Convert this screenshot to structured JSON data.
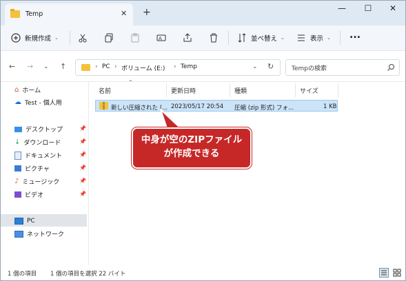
{
  "window": {
    "tab_title": "Temp",
    "new_tab": "+",
    "close_tab": "✕",
    "controls": {
      "minimize": "—",
      "maximize": "☐",
      "close": "✕"
    }
  },
  "commandbar": {
    "new_label": "新規作成",
    "sort_label": "並べ替え",
    "view_label": "表示",
    "more": "..."
  },
  "address": {
    "crumbs": [
      "PC",
      "ボリューム (E:)",
      "Temp"
    ],
    "search_placeholder": "Tempの検索"
  },
  "sidebar": {
    "items": [
      {
        "label": "ホーム"
      },
      {
        "label": "Test - 個人用"
      },
      {
        "label": "デスクトップ"
      },
      {
        "label": "ダウンロード"
      },
      {
        "label": "ドキュメント"
      },
      {
        "label": "ピクチャ"
      },
      {
        "label": "ミュージック"
      },
      {
        "label": "ビデオ"
      },
      {
        "label": "PC"
      },
      {
        "label": "ネットワーク"
      }
    ]
  },
  "table": {
    "columns": [
      "名前",
      "更新日時",
      "種類",
      "サイズ"
    ],
    "rows": [
      {
        "name": "新しい圧縮された (...",
        "date": "2023/05/17 20:54",
        "type": "圧縮 (zip 形式) フォ...",
        "size": "1 KB"
      }
    ]
  },
  "status": {
    "count": "1 個の項目",
    "selected": "1 個の項目を選択  22 バイト"
  },
  "callout": {
    "line1": "中身が空のZIPファイル",
    "line2": "が作成できる"
  },
  "colors": {
    "accent": "#c62828",
    "selection": "#cce4f7",
    "folder": "#f3c23c"
  }
}
